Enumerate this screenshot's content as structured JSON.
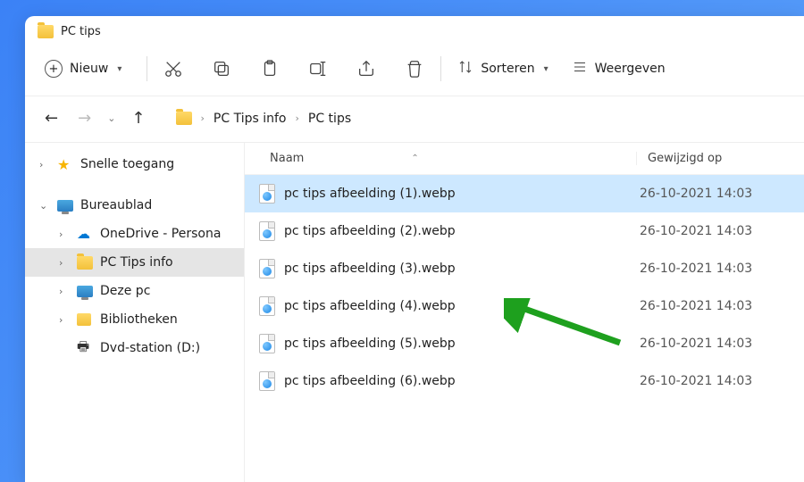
{
  "window": {
    "title": "PC tips"
  },
  "toolbar": {
    "new_label": "Nieuw",
    "sort_label": "Sorteren",
    "view_label": "Weergeven"
  },
  "breadcrumb": {
    "segments": [
      "PC Tips info",
      "PC tips"
    ]
  },
  "sidebar": {
    "quick_access": "Snelle toegang",
    "desktop": "Bureaublad",
    "onedrive": "OneDrive - Persona",
    "pctips_info": "PC Tips info",
    "this_pc": "Deze pc",
    "libraries": "Bibliotheken",
    "dvd": "Dvd-station (D:)"
  },
  "columns": {
    "name": "Naam",
    "date": "Gewijzigd op"
  },
  "files": [
    {
      "name": "pc tips afbeelding (1).webp",
      "date": "26-10-2021 14:03",
      "selected": true
    },
    {
      "name": "pc tips afbeelding (2).webp",
      "date": "26-10-2021 14:03",
      "selected": false
    },
    {
      "name": "pc tips afbeelding (3).webp",
      "date": "26-10-2021 14:03",
      "selected": false
    },
    {
      "name": "pc tips afbeelding (4).webp",
      "date": "26-10-2021 14:03",
      "selected": false
    },
    {
      "name": "pc tips afbeelding (5).webp",
      "date": "26-10-2021 14:03",
      "selected": false
    },
    {
      "name": "pc tips afbeelding (6).webp",
      "date": "26-10-2021 14:03",
      "selected": false
    }
  ]
}
